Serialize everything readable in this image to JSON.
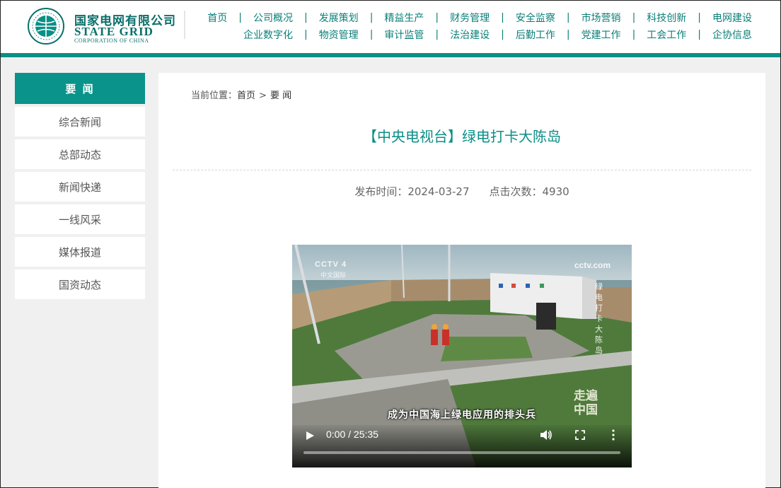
{
  "header": {
    "logo": {
      "name_cn": "国家电网有限公司",
      "name_en": "STATE GRID",
      "name_en_sub": "CORPORATION OF CHINA",
      "emblem_icon": "state-grid-globe-icon"
    },
    "nav_row1": [
      "首页",
      "公司概况",
      "发展策划",
      "精益生产",
      "财务管理",
      "安全监察",
      "市场营销",
      "科技创新",
      "电网建设"
    ],
    "nav_row2": [
      "企业数字化",
      "物资管理",
      "审计监管",
      "法治建设",
      "后勤工作",
      "党建工作",
      "工会工作",
      "企协信息"
    ],
    "separator": "|"
  },
  "sidebar": {
    "heading": "要 闻",
    "items": [
      "综合新闻",
      "总部动态",
      "新闻快递",
      "一线风采",
      "媒体报道",
      "国资动态"
    ]
  },
  "breadcrumb": {
    "label": "当前位置：",
    "home": "首页",
    "separator": ">",
    "current": "要 闻"
  },
  "article": {
    "title": "【中央电视台】绿电打卡大陈岛",
    "publish_label": "发布时间：2024-03-27",
    "views_label": "点击次数：4930"
  },
  "video": {
    "channel_logo": "CCTV 4",
    "channel_sub": "中文国际",
    "site_logo": "cctv.com",
    "vertical_caption": "绿电打卡大陈岛",
    "program_logo": "走遍中国",
    "subtitle": "成为中国海上绿电应用的排头兵",
    "time": "0:00 / 25:35",
    "progress": 0,
    "icons": [
      "play-icon",
      "volume-icon",
      "fullscreen-icon",
      "more-options-icon"
    ]
  },
  "colors": {
    "brand_teal": "#0a938a",
    "nav_text": "#0a7f78",
    "title_teal": "#0a8f86"
  }
}
